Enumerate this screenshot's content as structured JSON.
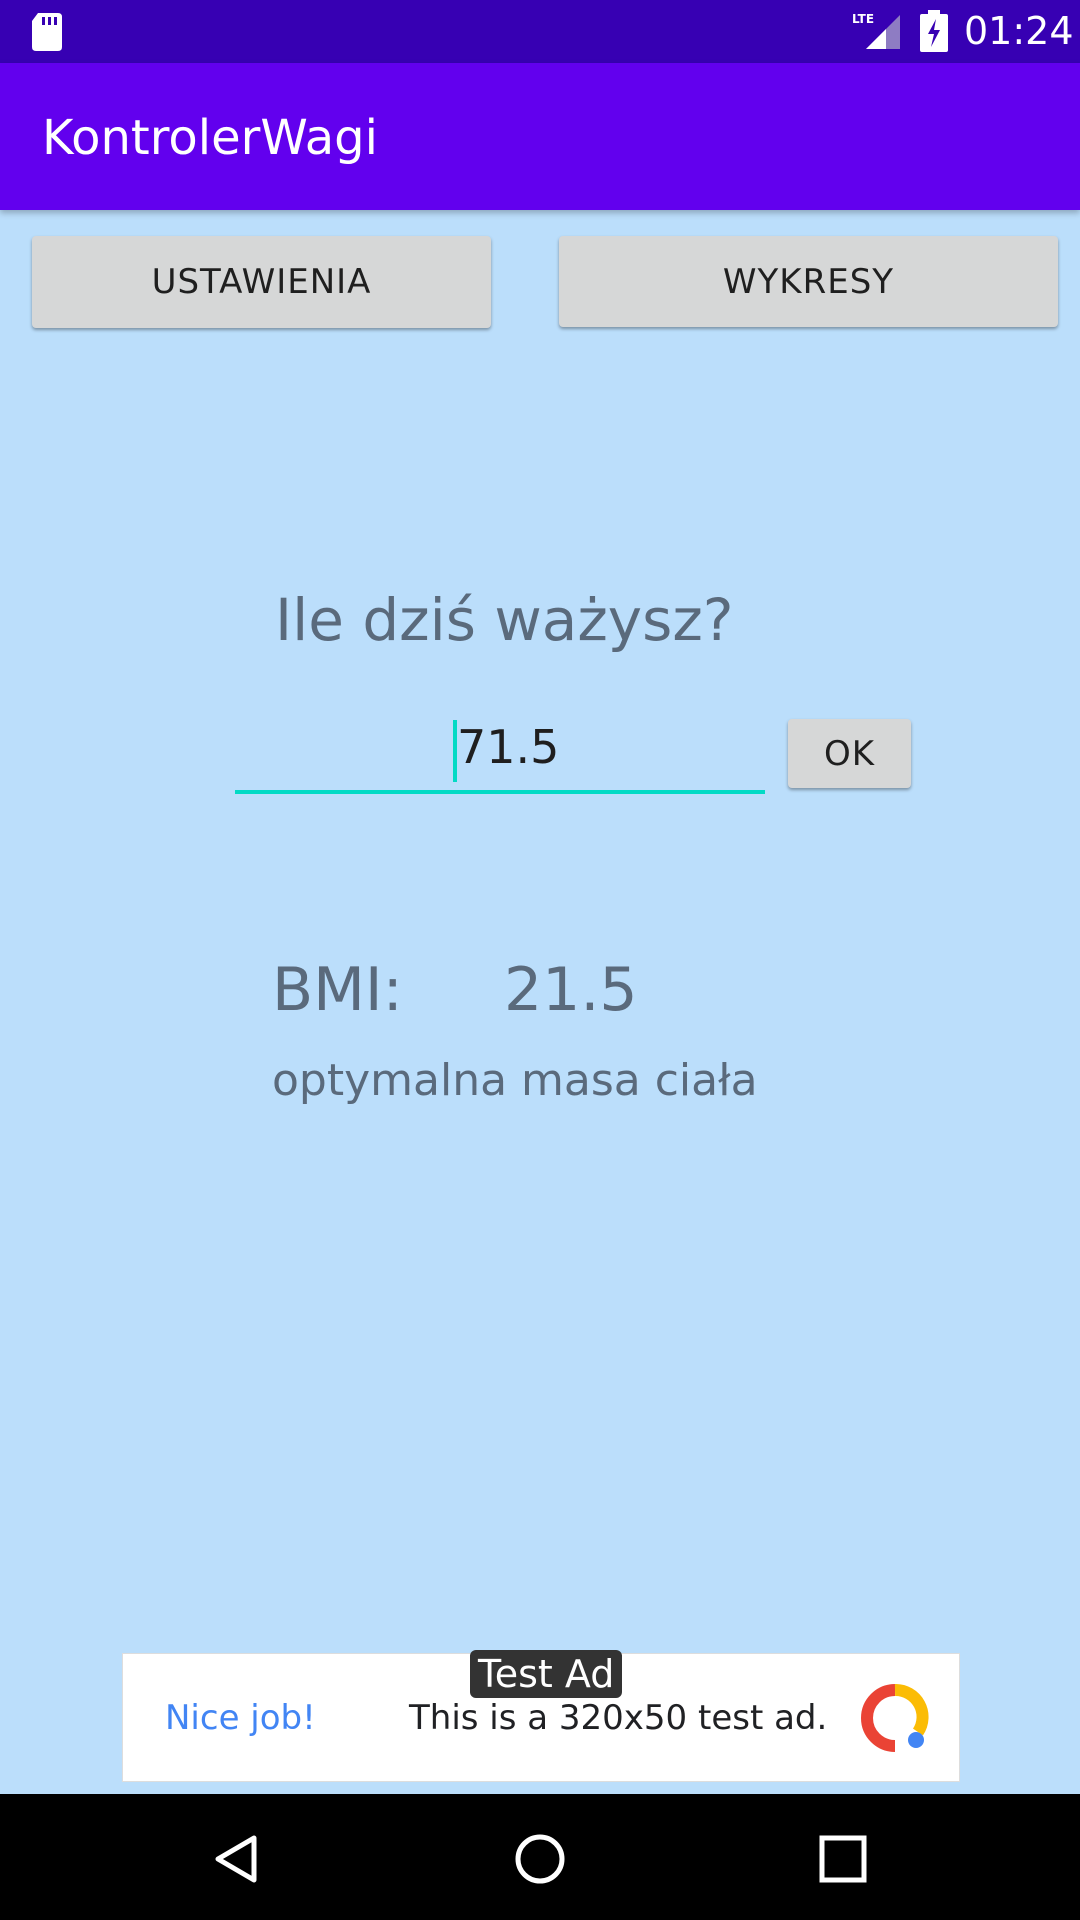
{
  "status_bar": {
    "time": "01:24",
    "network": "LTE"
  },
  "app_bar": {
    "title": "KontrolerWagi"
  },
  "buttons": {
    "settings": "USTAWIENIA",
    "charts": "WYKRESY",
    "ok": "OK"
  },
  "weight": {
    "question": "Ile dziś ważysz?",
    "input_value": "71.5"
  },
  "bmi": {
    "label": "BMI:",
    "value": "21.5",
    "status": "optymalna masa ciała"
  },
  "ad": {
    "tag": "Test Ad",
    "headline": "Nice job!",
    "text": "This is a 320x50 test ad."
  },
  "colors": {
    "status_bar": "#3700b3",
    "app_bar": "#6200ee",
    "background": "#bbdefb",
    "accent": "#03dac5",
    "button": "#d6d7d7"
  }
}
